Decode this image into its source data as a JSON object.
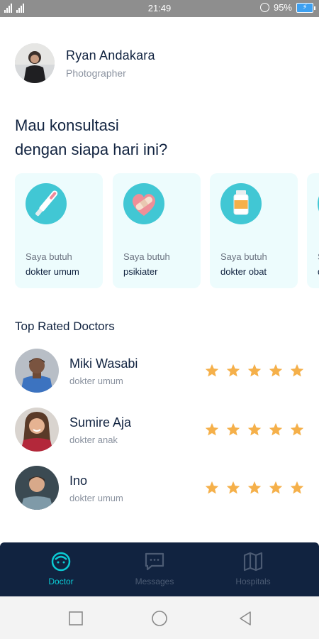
{
  "status_bar": {
    "time": "21:49",
    "battery": "95%"
  },
  "profile": {
    "name": "Ryan Andakara",
    "job": "Photographer"
  },
  "greeting": {
    "line1": "Mau konsultasi",
    "line2": "dengan siapa hari ini?"
  },
  "categories": [
    {
      "top": "Saya butuh",
      "bottom": "dokter umum",
      "icon": "thermometer-icon"
    },
    {
      "top": "Saya butuh",
      "bottom": "psikiater",
      "icon": "heart-bandage-icon"
    },
    {
      "top": "Saya butuh",
      "bottom": "dokter obat",
      "icon": "medicine-bottle-icon"
    },
    {
      "top": "S",
      "bottom": "d",
      "icon": "partial-icon"
    }
  ],
  "top_rated": {
    "title": "Top Rated Doctors",
    "doctors": [
      {
        "name": "Miki Wasabi",
        "category": "dokter umum",
        "rating": 5
      },
      {
        "name": "Sumire Aja",
        "category": "dokter anak",
        "rating": 5
      },
      {
        "name": "Ino",
        "category": "dokter umum",
        "rating": 5
      }
    ]
  },
  "bottom_nav": {
    "items": [
      {
        "label": "Doctor",
        "active": true
      },
      {
        "label": "Messages",
        "active": false
      },
      {
        "label": "Hospitals",
        "active": false
      }
    ]
  },
  "colors": {
    "primary": "#0BCAD4",
    "dark": "#112340",
    "card_bg": "#EDFCFD",
    "star": "#F5B04A",
    "nav_inactive": "#4C5B73"
  }
}
